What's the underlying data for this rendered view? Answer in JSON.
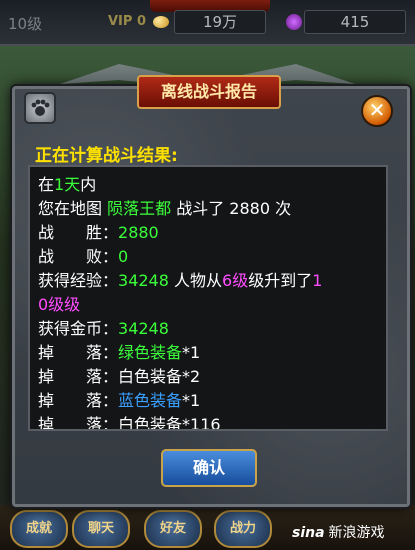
{
  "topbar": {
    "level": "10级",
    "vip": "VIP 0",
    "gold": "19万",
    "gems": "415",
    "coin_icon": "gold-coin-icon",
    "gem_icon": "purple-gem-icon"
  },
  "dialog": {
    "title": "离线战斗报告",
    "heading": "正在计算战斗结果:",
    "confirm_label": "确认",
    "close_icon": "close-icon",
    "paw_icon": "paw-icon",
    "report": {
      "line1": {
        "a": "在",
        "b": "1天",
        "c": "内"
      },
      "line2": {
        "a": "您在地图 ",
        "b": "陨落王都",
        "c": " 战斗了 2880 次"
      },
      "line3": {
        "a": "战　　胜：",
        "b": "2880"
      },
      "line4": {
        "a": "战　　败：",
        "b": "0"
      },
      "line5": {
        "a": "获得经验：",
        "b": "34248",
        "c": " 人物从",
        "d": "6级",
        "e": "级升到了",
        "f": "1"
      },
      "line6": {
        "a": "0级级"
      },
      "line7": {
        "a": "获得金币：",
        "b": "34248"
      },
      "line8": {
        "a": "掉　　落：",
        "b": "绿色装备",
        "c": "*1"
      },
      "line9": {
        "a": "掉　　落：",
        "b": "白色装备*2"
      },
      "line10": {
        "a": "掉　　落：",
        "b": "蓝色装备",
        "c": "*1"
      },
      "line11": {
        "a": "掉　　落：",
        "b": "白色装备*116"
      }
    }
  },
  "bottom_nav": [
    "成就",
    "聊天",
    "好友",
    "战力"
  ],
  "watermark": {
    "logo": "sina",
    "text": "新浪游戏"
  },
  "colors": {
    "highlight_green": "#3bff3b",
    "highlight_magenta": "#ff4dff",
    "highlight_blue": "#3aa0ff",
    "heading_yellow": "#ffe100"
  }
}
